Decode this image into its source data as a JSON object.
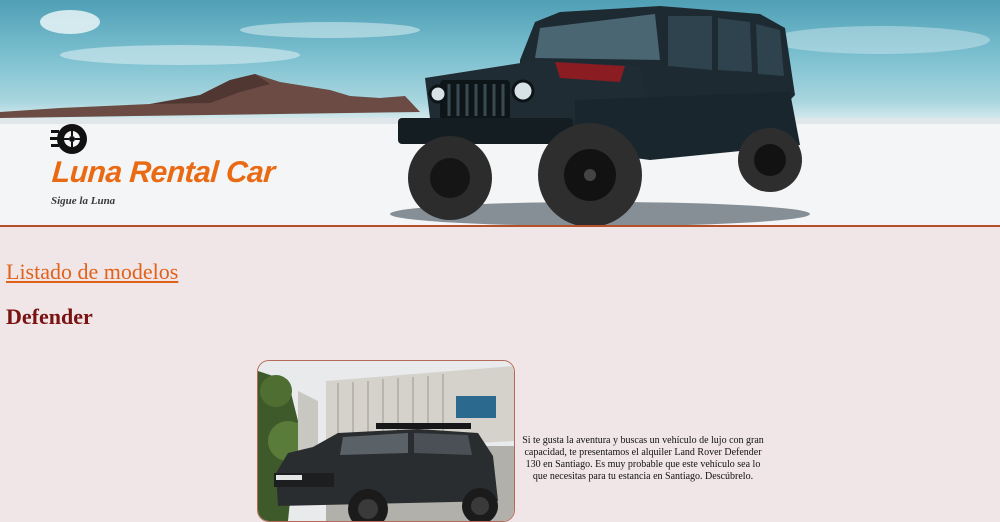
{
  "header": {
    "brand_name": "Luna Rental Car",
    "tagline": "Sigue la Luna",
    "logo_icon": "wheel-speed-icon",
    "accent_color": "#ea6a13"
  },
  "main": {
    "list_title": "Listado de modelos",
    "models": [
      {
        "name": "Defender",
        "description": "Si te gusta la aventura y buscas un vehículo de lujo con gran capacidad, te presentamos el alquiler Land Rover Defender 130 en Santiago. Es muy probable que este vehículo sea lo que necesitas para tu estancia en Santiago. Descúbrelo."
      }
    ]
  }
}
